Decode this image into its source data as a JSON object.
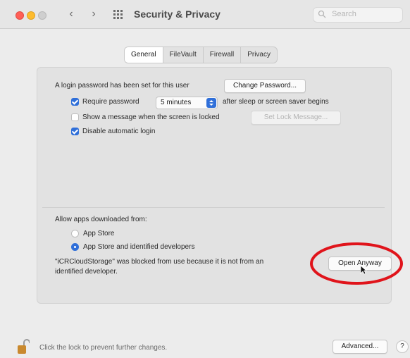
{
  "window": {
    "title": "Security & Privacy",
    "search_placeholder": "Search"
  },
  "tabs": [
    {
      "label": "General",
      "active": true
    },
    {
      "label": "FileVault",
      "active": false
    },
    {
      "label": "Firewall",
      "active": false
    },
    {
      "label": "Privacy",
      "active": false
    }
  ],
  "general": {
    "login_password_text": "A login password has been set for this user",
    "change_password_button": "Change Password...",
    "require_password_label": "Require password",
    "require_password_checked": true,
    "require_password_delay": "5 minutes",
    "after_sleep_text": "after sleep or screen saver begins",
    "show_message_label": "Show a message when the screen is locked",
    "show_message_checked": false,
    "set_lock_message_button": "Set Lock Message...",
    "disable_auto_login_label": "Disable automatic login",
    "disable_auto_login_checked": true
  },
  "apps": {
    "heading": "Allow apps downloaded from:",
    "options": [
      {
        "label": "App Store",
        "selected": false
      },
      {
        "label": "App Store and identified developers",
        "selected": true
      }
    ],
    "blocked_line1": "\"iCRCloudStorage\" was blocked from use because it is not from an",
    "blocked_line2": "identified developer.",
    "open_anyway_button": "Open Anyway"
  },
  "footer": {
    "lock_text": "Click the lock to prevent further changes.",
    "advanced_button": "Advanced...",
    "help_button": "?"
  },
  "colors": {
    "accent": "#2f6fd9",
    "annotation": "#e0141b"
  }
}
